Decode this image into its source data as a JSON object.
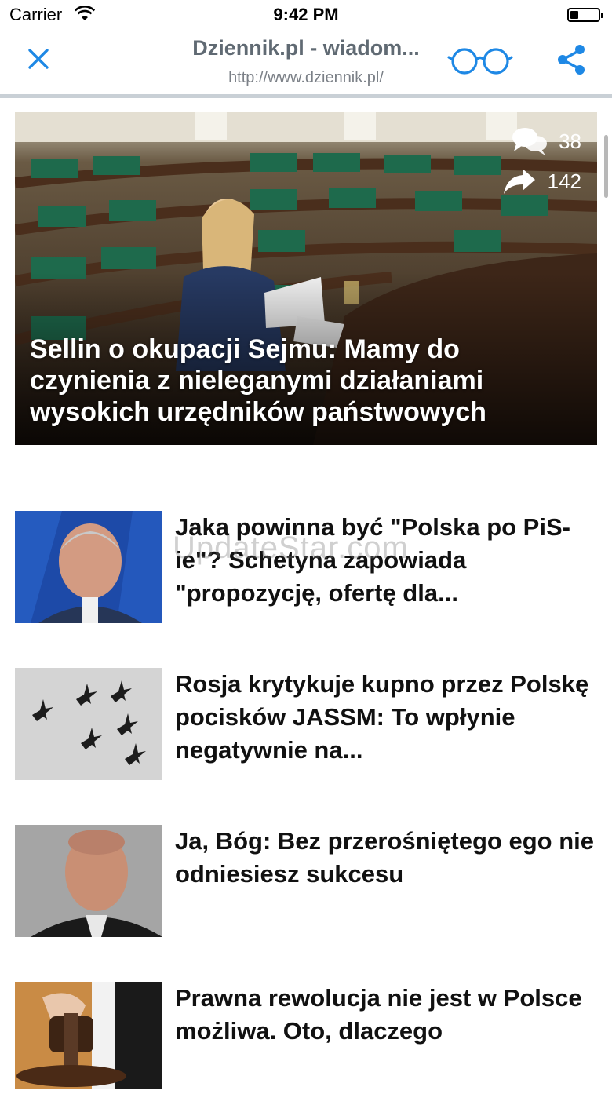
{
  "status_bar": {
    "carrier": "Carrier",
    "time": "9:42 PM"
  },
  "nav": {
    "title": "Dziennik.pl - wiadom...",
    "url": "http://www.dziennik.pl/",
    "close_icon": "close-icon",
    "reader_icon": "glasses-icon",
    "share_icon": "share-icon",
    "accent_color": "#1e88e5"
  },
  "hero": {
    "headline": "Sellin o okupacji Sejmu: Mamy do czynienia z nieleganymi działaniami wysokich urzędników państwowych",
    "comments_count": "38",
    "shares_count": "142"
  },
  "articles": [
    {
      "headline": "Jaka powinna być \"Polska po PiS-ie\"? Schetyna zapowiada \"propozycję, ofertę dla...",
      "thumb": "politician-portrait"
    },
    {
      "headline": "Rosja krytykuje kupno przez Polskę pocisków JASSM: To wpłynie negatywnie na...",
      "thumb": "fighter-jets-formation"
    },
    {
      "headline": "Ja, Bóg: Bez przerośniętego ego nie odniesiesz sukcesu",
      "thumb": "bald-man-portrait"
    },
    {
      "headline": "Prawna rewolucja nie jest w Polsce możliwa. Oto, dlaczego",
      "thumb": "judge-gavel"
    }
  ],
  "watermark": "UpdateStar.com"
}
